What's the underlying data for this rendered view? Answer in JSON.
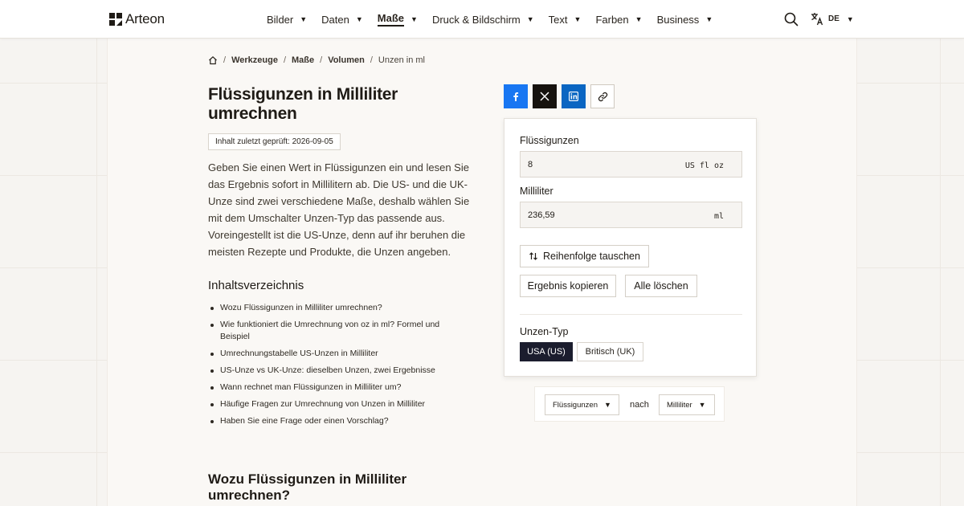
{
  "brand": {
    "name": "Arteon",
    "logo_icon": "arteon-logo-icon"
  },
  "nav": {
    "items": [
      {
        "label": "Bilder",
        "active": false
      },
      {
        "label": "Daten",
        "active": false
      },
      {
        "label": "Maße",
        "active": true
      },
      {
        "label": "Druck & Bildschirm",
        "active": false
      },
      {
        "label": "Text",
        "active": false
      },
      {
        "label": "Farben",
        "active": false
      },
      {
        "label": "Business",
        "active": false
      }
    ],
    "caret": "▼",
    "search_icon": "search-icon",
    "language": {
      "icon": "translate-icon",
      "code": "DE"
    }
  },
  "breadcrumb": {
    "home_icon": "home-icon",
    "separator": "/",
    "items": [
      "Werkzeuge",
      "Maße",
      "Volumen",
      "Unzen in ml"
    ]
  },
  "article": {
    "title": "Flüssigunzen in Milliliter umrechnen",
    "review_badge": "Inhalt zuletzt geprüft: 2026-09-05",
    "intro": "Geben Sie einen Wert in Flüssigunzen ein und lesen Sie das Ergebnis sofort in Millilitern ab. Die US- und die UK-Unze sind zwei verschiedene Maße, deshalb wählen Sie mit dem Umschalter Unzen-Typ das passende aus. Voreingestellt ist die US-Unze, denn auf ihr beruhen die meisten Rezepte und Produkte, die Unzen angeben.",
    "toc_title": "Inhaltsverzeichnis",
    "toc": [
      "Wozu Flüssigunzen in Milliliter umrechnen?",
      "Wie funktioniert die Umrechnung von oz in ml? Formel und Beispiel",
      "Umrechnungstabelle US-Unzen in Milliliter",
      "US-Unze vs UK-Unze: dieselben Unzen, zwei Ergebnisse",
      "Wann rechnet man Flüssigunzen in Milliliter um?",
      "Häufige Fragen zur Umrechnung von Unzen in Milliliter",
      "Haben Sie eine Frage oder einen Vorschlag?"
    ],
    "section_title": "Wozu Flüssigunzen in Milliliter umrechnen?"
  },
  "share": {
    "facebook_icon": "facebook-icon",
    "x_icon": "x-icon",
    "linkedin_icon": "linkedin-icon",
    "link_icon": "link-icon"
  },
  "converter": {
    "input_label": "Flüssigunzen",
    "input_value": "8",
    "input_unit": "US fl oz",
    "output_label": "Milliliter",
    "output_value": "236,59",
    "output_unit": "ml",
    "swap_label": "Reihenfolge tauschen",
    "swap_icon": "swap-vertical-icon",
    "copy_label": "Ergebnis kopieren",
    "clear_label": "Alle löschen",
    "ounce_type_label": "Unzen-Typ",
    "ounce_types": [
      "USA (US)",
      "Britisch (UK)"
    ],
    "selected_ounce_type": "USA (US)"
  },
  "unit_selector": {
    "from": "Flüssigunzen",
    "separator": "nach",
    "to": "Milliliter"
  },
  "colors": {
    "accent_dark": "#1b1d2e",
    "facebook": "#1877f2",
    "linkedin": "#0a66c2",
    "x": "#16120e",
    "page_bg": "#f6f4f1"
  }
}
